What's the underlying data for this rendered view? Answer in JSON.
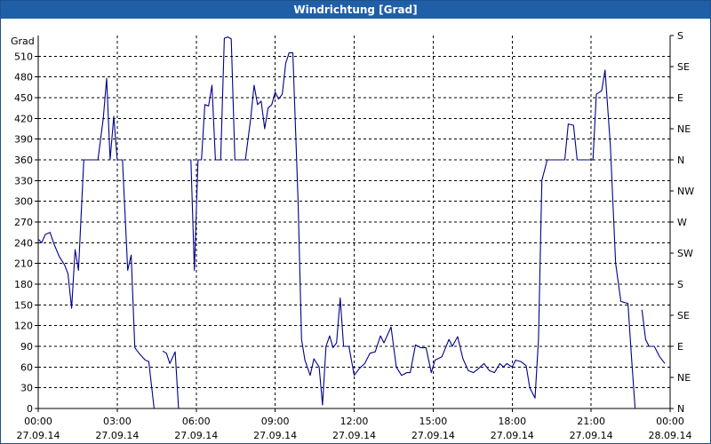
{
  "window": {
    "title": "Windrichtung [Grad]"
  },
  "chart_data": {
    "type": "line",
    "title": "Windrichtung [Grad]",
    "ylabel": "Grad",
    "xlabel": "",
    "xlim_hours": [
      0,
      24
    ],
    "ylim": [
      0,
      540
    ],
    "grid": true,
    "x_ticks": [
      {
        "time": "00:00",
        "date": "27.09.14",
        "hour": 0
      },
      {
        "time": "03:00",
        "date": "27.09.14",
        "hour": 3
      },
      {
        "time": "06:00",
        "date": "27.09.14",
        "hour": 6
      },
      {
        "time": "09:00",
        "date": "27.09.14",
        "hour": 9
      },
      {
        "time": "12:00",
        "date": "27.09.14",
        "hour": 12
      },
      {
        "time": "15:00",
        "date": "27.09.14",
        "hour": 15
      },
      {
        "time": "18:00",
        "date": "27.09.14",
        "hour": 18
      },
      {
        "time": "21:00",
        "date": "27.09.14",
        "hour": 21
      },
      {
        "time": "00:00",
        "date": "28.09.14",
        "hour": 24
      }
    ],
    "y_ticks_left": [
      0,
      30,
      60,
      90,
      120,
      150,
      180,
      210,
      240,
      270,
      300,
      330,
      360,
      390,
      420,
      450,
      480,
      510
    ],
    "y_ticks_right": [
      {
        "value": 0,
        "label": "N"
      },
      {
        "value": 45,
        "label": "NE"
      },
      {
        "value": 90,
        "label": "E"
      },
      {
        "value": 135,
        "label": "SE"
      },
      {
        "value": 180,
        "label": "S"
      },
      {
        "value": 225,
        "label": "SW"
      },
      {
        "value": 270,
        "label": "W"
      },
      {
        "value": 315,
        "label": "NW"
      },
      {
        "value": 360,
        "label": "N"
      },
      {
        "value": 405,
        "label": "NE"
      },
      {
        "value": 450,
        "label": "E"
      },
      {
        "value": 495,
        "label": "SE"
      },
      {
        "value": 540,
        "label": "S"
      }
    ],
    "color": "#00008b",
    "segments": [
      [
        [
          0.0,
          245
        ],
        [
          0.13,
          240
        ],
        [
          0.27,
          252
        ],
        [
          0.45,
          255
        ],
        [
          0.6,
          238
        ],
        [
          0.8,
          220
        ],
        [
          1.0,
          208
        ],
        [
          1.13,
          195
        ],
        [
          1.27,
          145
        ],
        [
          1.4,
          230
        ],
        [
          1.53,
          200
        ],
        [
          1.73,
          360
        ],
        [
          2.0,
          360
        ],
        [
          2.27,
          360
        ],
        [
          2.47,
          420
        ],
        [
          2.6,
          478
        ],
        [
          2.73,
          360
        ],
        [
          2.87,
          423
        ],
        [
          3.0,
          360
        ],
        [
          3.2,
          360
        ],
        [
          3.4,
          200
        ],
        [
          3.53,
          222
        ],
        [
          3.67,
          88
        ],
        [
          3.87,
          78
        ],
        [
          4.07,
          70
        ],
        [
          4.2,
          68
        ],
        [
          4.4,
          0
        ]
      ],
      [
        [
          4.73,
          83
        ],
        [
          4.87,
          80
        ],
        [
          5.0,
          65
        ],
        [
          5.2,
          82
        ],
        [
          5.33,
          0
        ]
      ],
      [
        [
          5.67,
          360
        ],
        [
          5.8,
          360
        ],
        [
          5.93,
          200
        ],
        [
          6.07,
          360
        ],
        [
          6.2,
          360
        ],
        [
          6.33,
          440
        ],
        [
          6.47,
          438
        ],
        [
          6.6,
          468
        ],
        [
          6.73,
          360
        ],
        [
          6.93,
          360
        ],
        [
          7.07,
          536
        ],
        [
          7.2,
          538
        ],
        [
          7.33,
          535
        ],
        [
          7.47,
          360
        ],
        [
          7.67,
          360
        ],
        [
          7.87,
          360
        ],
        [
          8.07,
          420
        ],
        [
          8.2,
          468
        ],
        [
          8.33,
          440
        ],
        [
          8.47,
          445
        ],
        [
          8.6,
          405
        ],
        [
          8.73,
          435
        ],
        [
          8.87,
          440
        ],
        [
          9.0,
          458
        ],
        [
          9.13,
          448
        ],
        [
          9.27,
          455
        ],
        [
          9.4,
          500
        ],
        [
          9.53,
          515
        ],
        [
          9.67,
          515
        ],
        [
          9.87,
          300
        ],
        [
          10.0,
          100
        ],
        [
          10.13,
          70
        ],
        [
          10.33,
          48
        ],
        [
          10.47,
          72
        ],
        [
          10.67,
          60
        ],
        [
          10.8,
          5
        ],
        [
          10.93,
          90
        ],
        [
          11.07,
          105
        ],
        [
          11.2,
          88
        ],
        [
          11.33,
          95
        ],
        [
          11.47,
          160
        ],
        [
          11.6,
          90
        ],
        [
          11.8,
          90
        ],
        [
          12.0,
          48
        ],
        [
          12.2,
          58
        ],
        [
          12.4,
          65
        ],
        [
          12.6,
          80
        ],
        [
          12.8,
          82
        ],
        [
          13.0,
          105
        ],
        [
          13.13,
          95
        ],
        [
          13.4,
          118
        ],
        [
          13.6,
          60
        ],
        [
          13.8,
          48
        ],
        [
          14.0,
          52
        ],
        [
          14.13,
          52
        ],
        [
          14.33,
          92
        ],
        [
          14.53,
          88
        ],
        [
          14.73,
          88
        ],
        [
          14.93,
          52
        ],
        [
          15.07,
          70
        ],
        [
          15.33,
          75
        ],
        [
          15.6,
          100
        ],
        [
          15.73,
          90
        ],
        [
          15.93,
          104
        ],
        [
          16.13,
          72
        ],
        [
          16.33,
          55
        ],
        [
          16.53,
          52
        ],
        [
          16.73,
          58
        ],
        [
          16.93,
          65
        ],
        [
          17.13,
          55
        ],
        [
          17.33,
          52
        ],
        [
          17.53,
          65
        ],
        [
          17.67,
          60
        ],
        [
          17.8,
          65
        ],
        [
          18.0,
          60
        ],
        [
          18.13,
          70
        ],
        [
          18.33,
          68
        ],
        [
          18.53,
          62
        ],
        [
          18.67,
          30
        ],
        [
          18.87,
          15
        ],
        [
          19.0,
          100
        ],
        [
          19.13,
          330
        ],
        [
          19.33,
          360
        ],
        [
          19.53,
          360
        ],
        [
          19.73,
          360
        ],
        [
          20.0,
          360
        ],
        [
          20.13,
          412
        ],
        [
          20.33,
          410
        ],
        [
          20.47,
          360
        ],
        [
          20.67,
          360
        ],
        [
          20.87,
          360
        ],
        [
          21.07,
          360
        ],
        [
          21.2,
          455
        ],
        [
          21.4,
          460
        ],
        [
          21.53,
          490
        ],
        [
          21.73,
          380
        ],
        [
          21.93,
          210
        ],
        [
          22.13,
          155
        ],
        [
          22.4,
          152
        ],
        [
          22.53,
          75
        ],
        [
          22.67,
          0
        ]
      ],
      [
        [
          22.93,
          143
        ],
        [
          23.07,
          100
        ],
        [
          23.2,
          90
        ],
        [
          23.4,
          90
        ],
        [
          23.6,
          75
        ],
        [
          23.8,
          65
        ]
      ]
    ]
  }
}
